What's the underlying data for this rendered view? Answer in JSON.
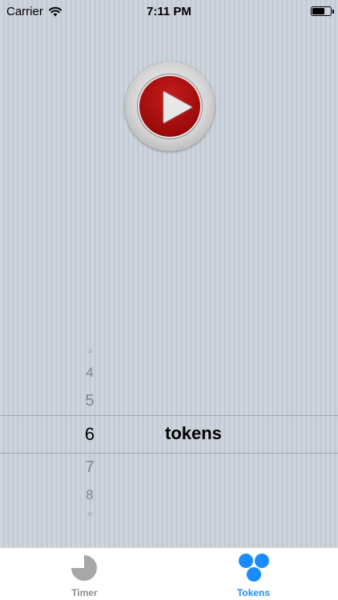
{
  "status_bar": {
    "carrier": "Carrier",
    "time": "7:11 PM",
    "battery_level": 0.7,
    "icons": [
      "wifi-icon",
      "battery-icon"
    ]
  },
  "main": {
    "play_button_icon": "play-icon"
  },
  "picker": {
    "numbers": [
      "3",
      "4",
      "5",
      "6",
      "7",
      "8",
      "9"
    ],
    "selected_index": 3,
    "label": "tokens"
  },
  "tab_bar": {
    "tabs": [
      {
        "label": "Timer",
        "icon": "timer-pie-icon",
        "active": false
      },
      {
        "label": "Tokens",
        "icon": "tokens-circles-icon",
        "active": true
      }
    ],
    "active_color": "#1a8cff",
    "inactive_color": "#8e8e93"
  }
}
